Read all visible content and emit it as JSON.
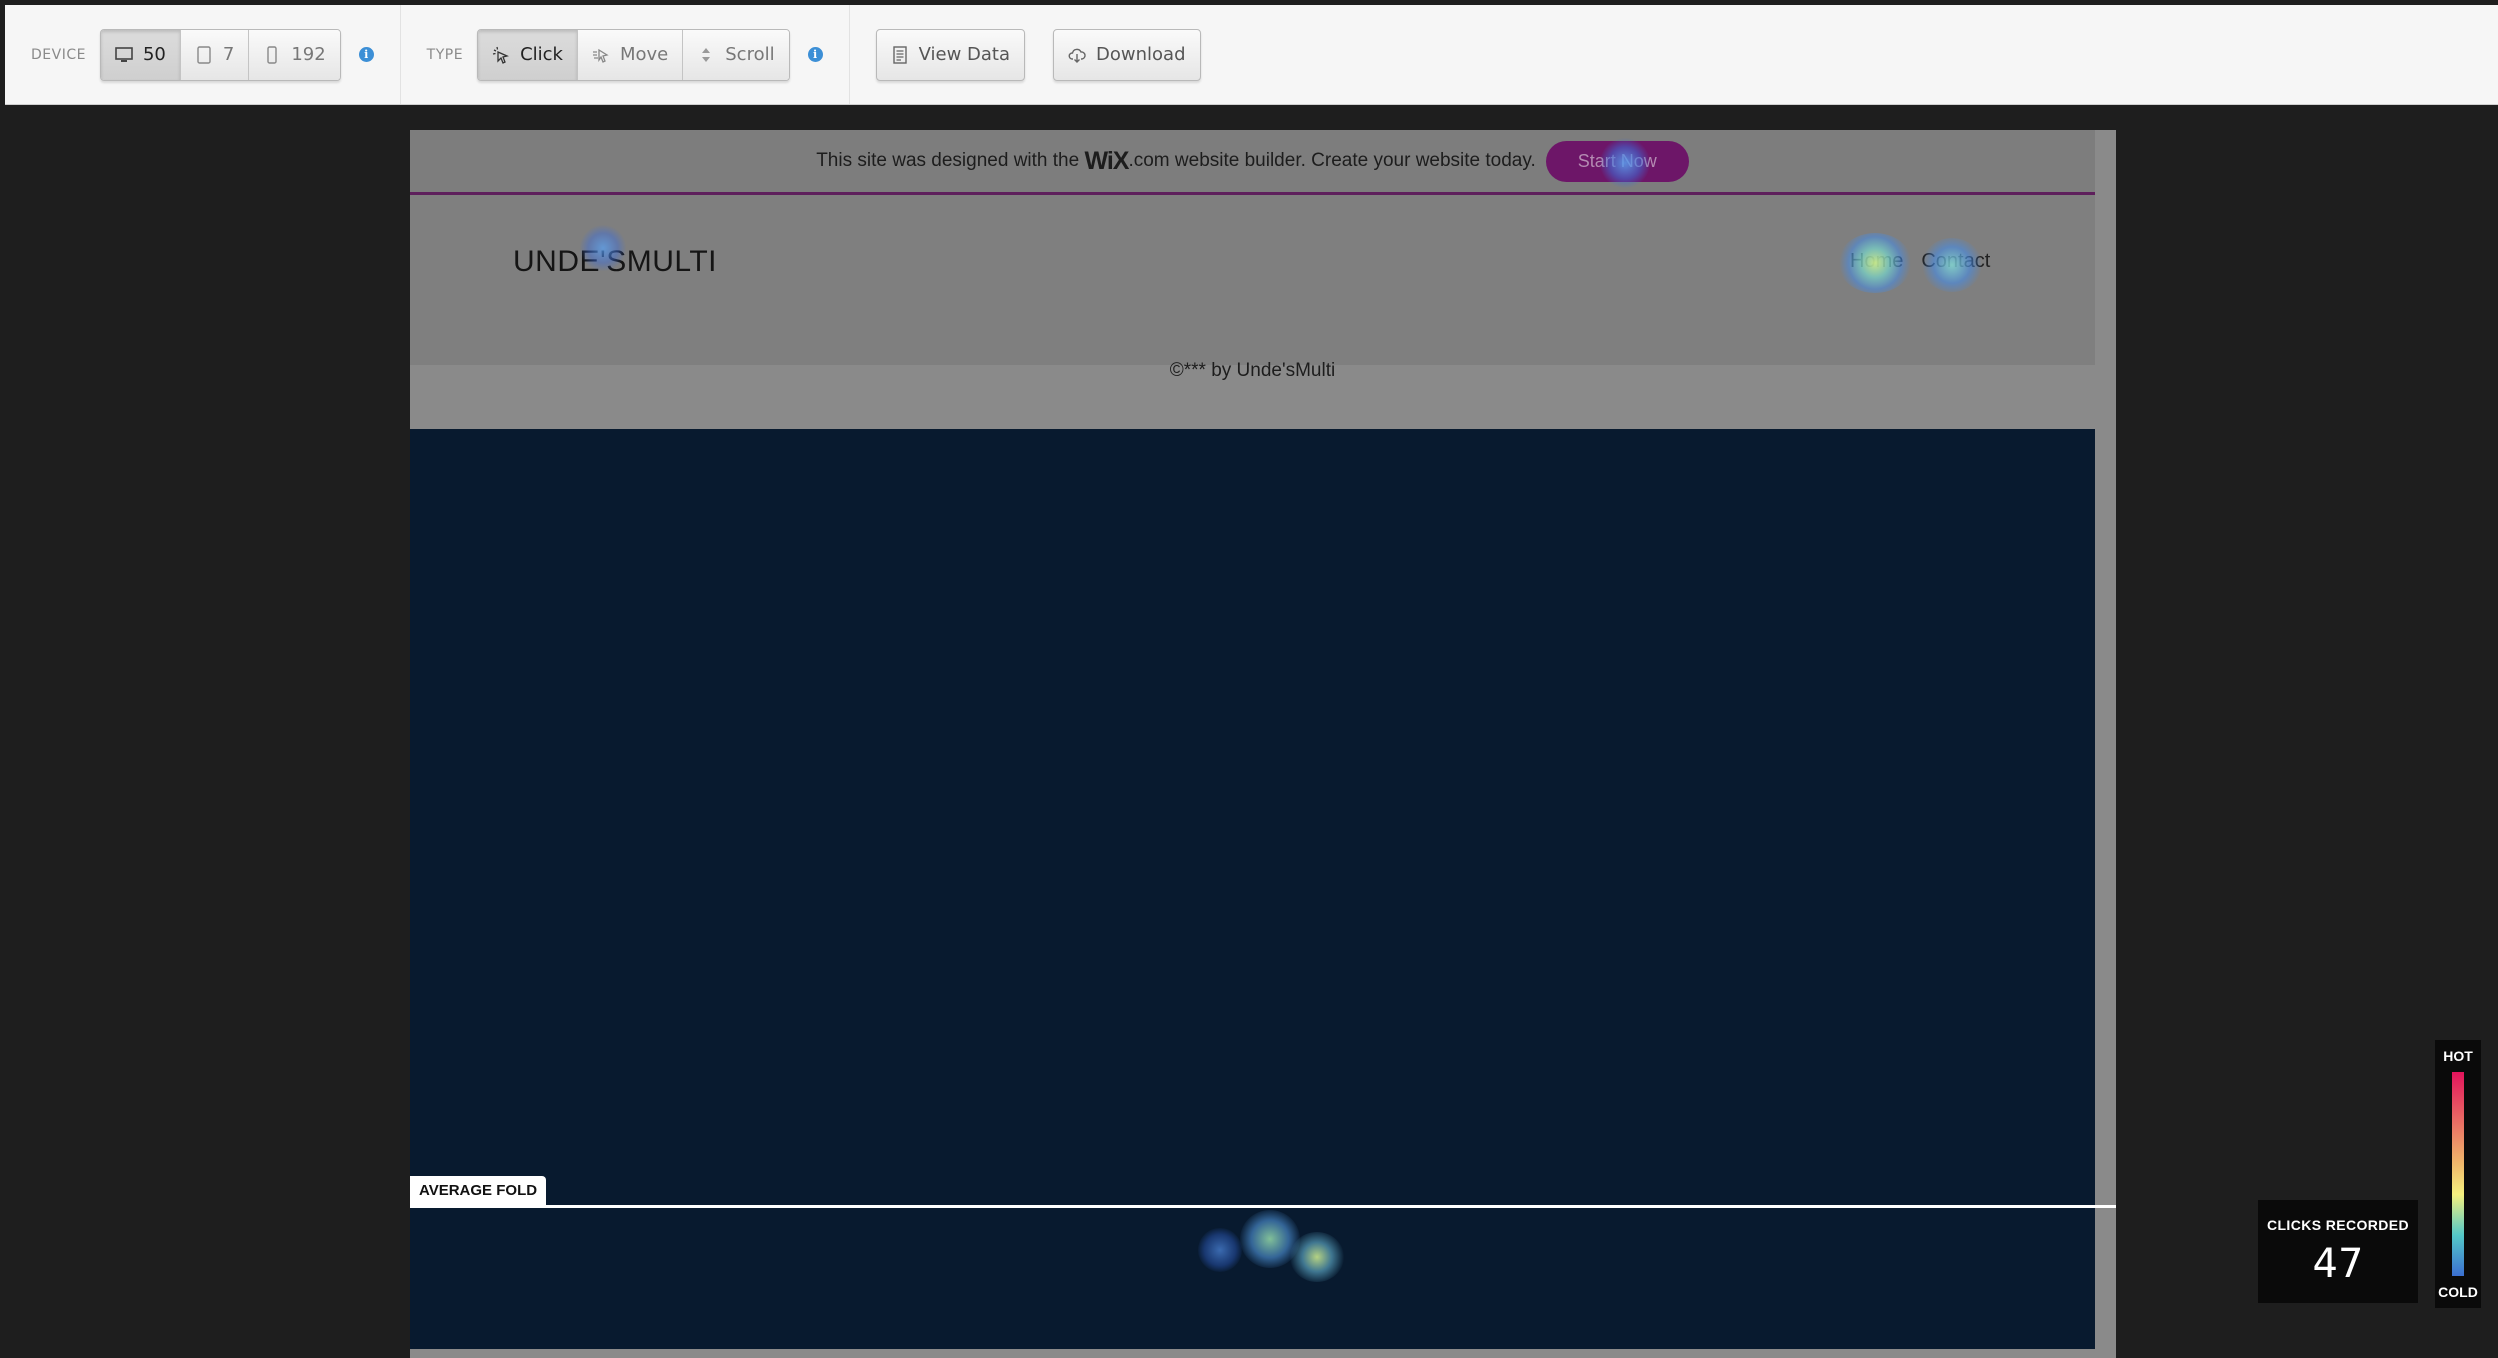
{
  "toolbar": {
    "device": {
      "label": "DEVICE",
      "desktop_count": "50",
      "tablet_count": "7",
      "mobile_count": "192"
    },
    "type": {
      "label": "TYPE",
      "click_label": "Click",
      "move_label": "Move",
      "scroll_label": "Scroll"
    },
    "view_data_label": "View Data",
    "download_label": "Download"
  },
  "site": {
    "banner_prefix": "This site was designed with the",
    "banner_logo": "WiX",
    "banner_suffix": ".com website builder. Create your website today.",
    "start_now_label": "Start Now",
    "logo_text": "UNDE'SMULTI",
    "nav_home": "Home",
    "nav_contact": "Contact",
    "copyright": "©*** by Unde'sMulti"
  },
  "fold_label": "AVERAGE FOLD",
  "scale": {
    "hot": "HOT",
    "cold": "COLD"
  },
  "clicks": {
    "label": "CLICKS RECORDED",
    "value": "47"
  },
  "colors": {
    "dark_section": "#081a2f",
    "start_button": "#6d1668",
    "accent_info": "#3c8fd6"
  }
}
